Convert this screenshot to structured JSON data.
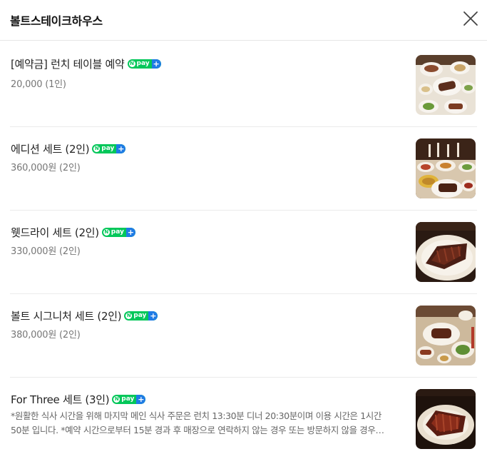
{
  "header": {
    "title": "볼트스테이크하우스",
    "close_icon": "close-icon"
  },
  "badge": {
    "n": "N",
    "pay": "pay",
    "plus": "+"
  },
  "colors": {
    "npay_green": "#03c75a",
    "npay_blue": "#1f7be5",
    "divider": "#ebebeb"
  },
  "menu_items": [
    {
      "name": "[예약금] 런치 테이블 예약",
      "price": "20,000 (1인)",
      "badge": "npay-plus-icon",
      "image": "lunch-table-photo"
    },
    {
      "name": "에디션 세트 (2인)",
      "price": "360,000원 (2인)",
      "badge": "npay-plus-icon",
      "image": "edition-set-photo"
    },
    {
      "name": "웻드라이 세트 (2인)",
      "price": "330,000원 (2인)",
      "badge": "npay-plus-icon",
      "image": "wet-dry-set-photo"
    },
    {
      "name": "볼트 시그니처 세트 (2인)",
      "price": "380,000원 (2인)",
      "badge": "npay-plus-icon",
      "image": "signature-set-photo"
    },
    {
      "name": "For Three 세트 (3인)",
      "badge": "npay-plus-icon",
      "image": "for-three-set-photo",
      "desc_line1": "*원활한 식사 시간을 위해 마지막 메인 식사 주문은 런치 13:30분 디너 20:30분이며 이용 시간은 1시간",
      "desc_line2": "50분 입니다. *예약 시간으로부터 15분 경과 후 매장으로 연락하지 않는 경우 또는 방문하지 않을 경우…"
    }
  ]
}
